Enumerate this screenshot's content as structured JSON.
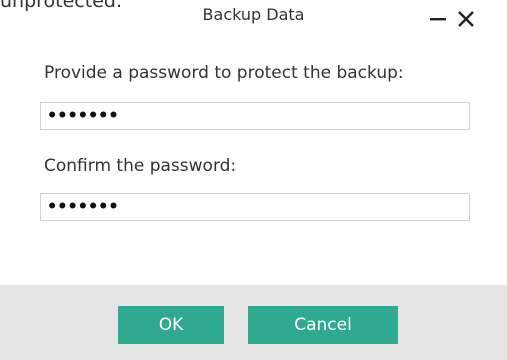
{
  "background_partial_text": "unprotected.",
  "dialog": {
    "title": "Backup Data",
    "password_label": "Provide a password to protect the backup:",
    "password_value": "•••••••",
    "confirm_label": "Confirm the password:",
    "confirm_value": "•••••••",
    "ok_label": "OK",
    "cancel_label": "Cancel"
  },
  "icons": {
    "minimize": "minimize-icon",
    "close": "close-icon"
  },
  "colors": {
    "button": "#2fa98f",
    "footer": "#e6e6e6",
    "field_border": "#c9d4dc"
  }
}
